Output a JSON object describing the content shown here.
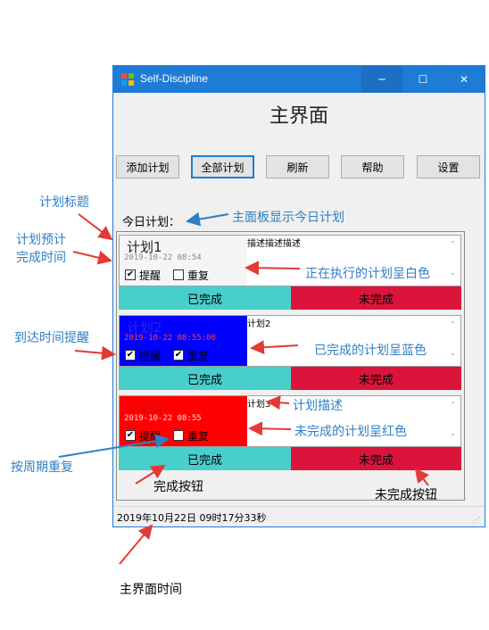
{
  "window": {
    "title": "Self-Discipline",
    "main_title": "主界面",
    "controls": {
      "minimize": "─",
      "maximize": "☐",
      "close": "✕"
    }
  },
  "toolbar": {
    "add_label": "添加计划",
    "all_label": "全部计划",
    "refresh_label": "刷新",
    "help_label": "帮助",
    "settings_label": "设置"
  },
  "today_label": "今日计划：",
  "plans": [
    {
      "title": "计划1",
      "time": "2019-10-22 08:54",
      "remind_label": "提醒",
      "remind": true,
      "repeat_label": "重复",
      "repeat": false,
      "description": "描述描述描述",
      "color": "#f5f5f5",
      "done_label": "已完成",
      "undone_label": "未完成"
    },
    {
      "title": "计划2",
      "time": "2019-10-22 08:55:00",
      "remind_label": "提醒",
      "remind": true,
      "repeat_label": "重复",
      "repeat": true,
      "description": "计划2",
      "color": "#0000ff",
      "done_label": "已完成",
      "undone_label": "未完成"
    },
    {
      "title": "计划3",
      "time": "2019-10-22 08:55",
      "remind_label": "提醒",
      "remind": true,
      "repeat_label": "重复",
      "repeat": false,
      "description": "计划3",
      "color": "#ff0000",
      "done_label": "已完成",
      "undone_label": "未完成"
    }
  ],
  "status_time": "2019年10月22日  09时17分33秒",
  "annotations": {
    "plan_title": "计划标题",
    "plan_deadline_l1": "计划预计",
    "plan_deadline_l2": "完成时间",
    "reminder": "到达时间提醒",
    "repeat_weekly": "按周期重复",
    "today_panel": "主面板显示今日计划",
    "in_progress_white": "正在执行的计划呈白色",
    "done_blue": "已完成的计划呈蓝色",
    "plan_desc": "计划描述",
    "undone_red": "未完成的计划呈红色",
    "done_button": "完成按钮",
    "undone_button": "未完成按钮",
    "main_time": "主界面时间"
  },
  "colors": {
    "accent": "#1e7bd6",
    "done": "#48cfcb",
    "undone": "#dc143c",
    "annotation": "#2e7fc6",
    "arrow": "#e53935"
  }
}
